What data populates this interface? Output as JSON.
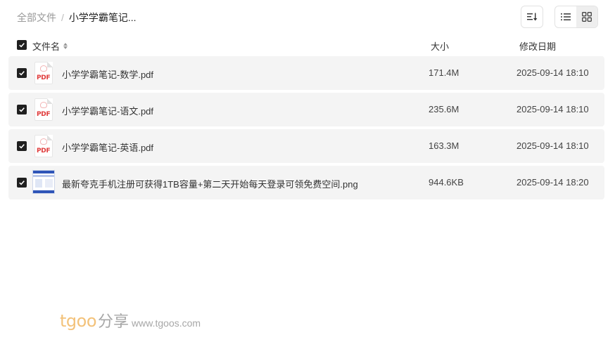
{
  "breadcrumb": {
    "root": "全部文件",
    "separator": "/",
    "current": "小学学霸笔记..."
  },
  "toolbar": {
    "sort_icon": "sort-icon",
    "view_modes": [
      "list-view-icon",
      "grid-view-icon"
    ]
  },
  "table": {
    "headers": {
      "name": "文件名",
      "size": "大小",
      "modified": "修改日期"
    },
    "rows": [
      {
        "type": "pdf",
        "icon_label": "PDF",
        "name": "小学学霸笔记-数学.pdf",
        "size": "171.4M",
        "modified": "2025-09-14 18:10"
      },
      {
        "type": "pdf",
        "icon_label": "PDF",
        "name": "小学学霸笔记-语文.pdf",
        "size": "235.6M",
        "modified": "2025-09-14 18:10"
      },
      {
        "type": "pdf",
        "icon_label": "PDF",
        "name": "小学学霸笔记-英语.pdf",
        "size": "163.3M",
        "modified": "2025-09-14 18:10"
      },
      {
        "type": "png",
        "name": "最新夸克手机注册可获得1TB容量+第二天开始每天登录可领免费空间.png",
        "size": "944.6KB",
        "modified": "2025-09-14 18:20"
      }
    ]
  },
  "watermark": {
    "brand": "tgoo",
    "share": "分享",
    "url": "www.tgoos.com"
  },
  "colors": {
    "row_background": "#f4f4f4",
    "checkbox": "#1f1f1f",
    "pdf_red": "#e03b3b",
    "watermark_brand": "#f3c27a"
  }
}
